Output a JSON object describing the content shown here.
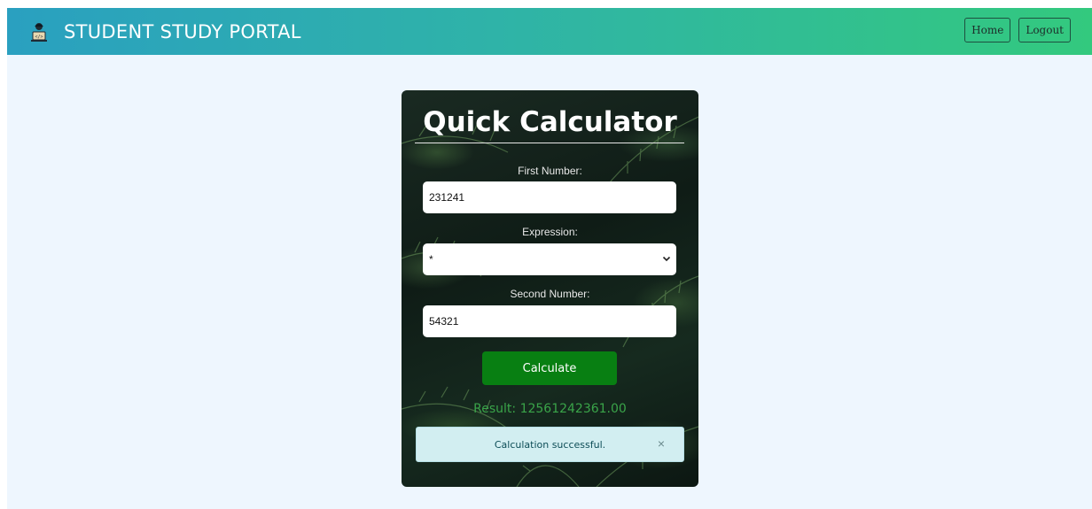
{
  "navbar": {
    "brand_icon": "coder-laptop-icon",
    "brand": "STUDENT STUDY PORTAL",
    "home_label": "Home",
    "logout_label": "Logout"
  },
  "calculator": {
    "title": "Quick Calculator",
    "first_label": "First Number:",
    "first_value": "231241",
    "expression_label": "Expression:",
    "expression_value": "*",
    "second_label": "Second Number:",
    "second_value": "54321",
    "button_label": "Calculate",
    "result": "Result: 12561242361.00",
    "alert_message": "Calculation successful.",
    "alert_close": "×",
    "alert_close_icon": "close-icon"
  },
  "colors": {
    "navbar_start": "#2aa0c0",
    "navbar_end": "#33c97e",
    "page_bg": "#eef6fe",
    "button_green": "#087f12",
    "result_green": "#3aa449",
    "alert_bg": "#d2eef1"
  }
}
